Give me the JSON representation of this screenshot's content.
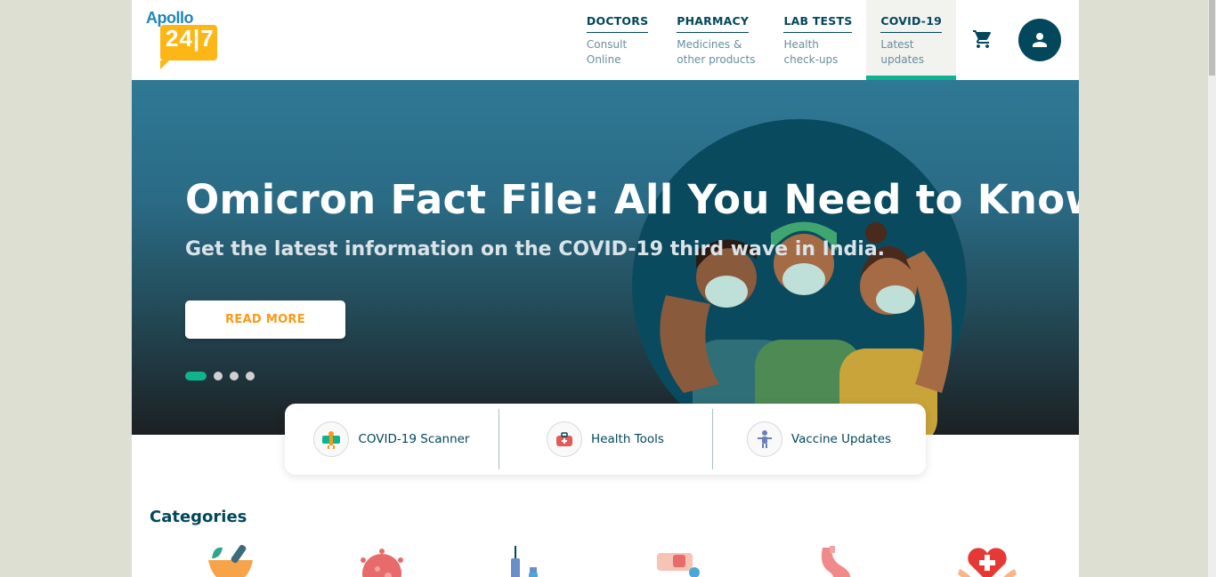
{
  "logo": {
    "brand": "Apollo",
    "number": "24|7"
  },
  "nav": [
    {
      "title": "DOCTORS",
      "subtitle": "Consult\nOnline"
    },
    {
      "title": "PHARMACY",
      "subtitle": "Medicines &\nother products"
    },
    {
      "title": "LAB TESTS",
      "subtitle": "Health\ncheck-ups"
    },
    {
      "title": "COVID-19",
      "subtitle": "Latest\nupdates"
    }
  ],
  "icons": {
    "cart": "cart-icon",
    "profile": "user-icon"
  },
  "hero": {
    "title": "Omicron Fact File: All You Need to Know",
    "subtitle": "Get the latest information on the COVID-19 third wave in India.",
    "button": "READ MORE",
    "slides_count": 4,
    "active_slide": 1
  },
  "quick_links": [
    {
      "label": "COVID-19 Scanner",
      "icon": "scanner-icon"
    },
    {
      "label": "Health Tools",
      "icon": "health-kit-icon"
    },
    {
      "label": "Vaccine Updates",
      "icon": "vaccine-person-icon"
    }
  ],
  "categories": {
    "title": "Categories",
    "items": [
      "herbal-mortar-icon",
      "virus-icon",
      "vaccine-vials-icon",
      "bandage-icon",
      "stomach-icon",
      "heart-hands-icon"
    ]
  },
  "colors": {
    "brand_dark": "#02475b",
    "accent_green": "#0fb38e",
    "accent_orange": "#fc9916",
    "logo_yellow": "#fcb716",
    "logo_blue": "#1f87b8"
  }
}
